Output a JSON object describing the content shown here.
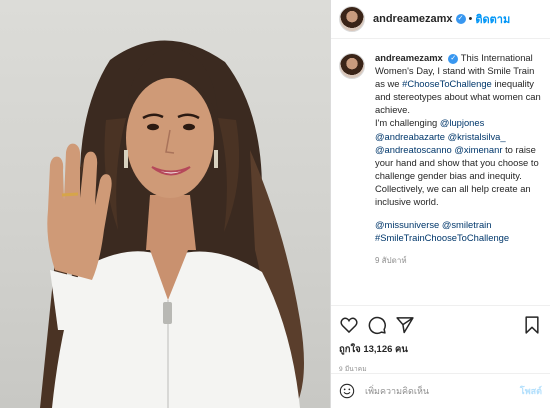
{
  "header": {
    "username": "andreamezamx",
    "separator": "•",
    "follow_label": "ติดตาม"
  },
  "caption": {
    "username": "andreamezamx",
    "line1": "This International Women's Day, I stand with Smile Train as we",
    "hashtag1": "#ChooseToChallenge",
    "line2": "inequality and stereotypes about what women can achieve.",
    "line3": "I'm challenging",
    "mention1": "@lupjones",
    "mention2": "@andreabazarte",
    "mention3": "@kristalsilva_",
    "mention4": "@andreatoscanno",
    "mention5": "@ximenanr",
    "line4": "to raise your hand and show that you choose to challenge gender bias and inequity. Collectively, we can all help create an inclusive world.",
    "mention6": "@missuniverse",
    "mention7": "@smiletrain",
    "hashtag2": "#SmileTrainChooseToChallenge",
    "time": "9 สัปดาห์"
  },
  "load_more_symbol": "+",
  "actions": {
    "icons": [
      "heart-icon",
      "comment-icon",
      "share-icon",
      "bookmark-icon"
    ],
    "likes": "ถูกใจ 13,126 คน",
    "date": "9 มีนาคม"
  },
  "add_comment": {
    "placeholder": "เพิ่มความคิดเห็น",
    "post_label": "โพสต์"
  },
  "colors": {
    "link": "#00376b",
    "follow": "#0095f6",
    "verified": "#3897f0",
    "muted": "#8e8e8e",
    "post_disabled": "#b2dffc"
  }
}
